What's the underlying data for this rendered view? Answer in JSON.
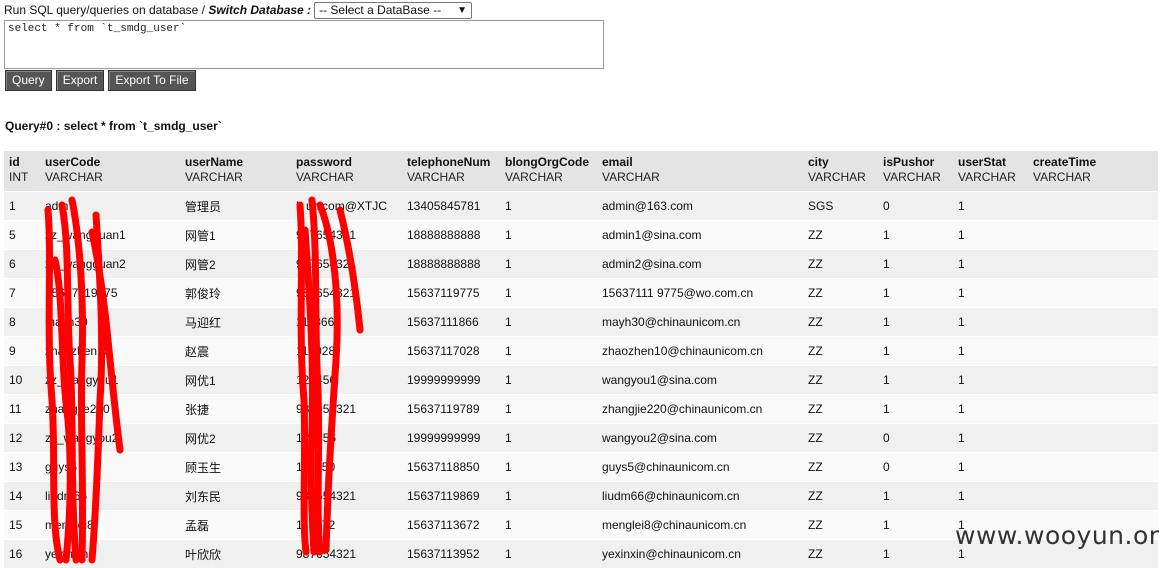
{
  "top": {
    "label_run": "Run SQL query/queries on database / ",
    "label_switch": "Switch Database :",
    "db_select": "-- Select a DataBase --"
  },
  "query_text": "select * from `t_smdg_user`",
  "buttons": {
    "query": "Query",
    "export": "Export",
    "export_file": "Export To File"
  },
  "query_title": "Query#0 : select * from `t_smdg_user`",
  "table": {
    "columns": [
      {
        "name": "id",
        "type": "INT"
      },
      {
        "name": "userCode",
        "type": "VARCHAR"
      },
      {
        "name": "userName",
        "type": "VARCHAR"
      },
      {
        "name": "password",
        "type": "VARCHAR"
      },
      {
        "name": "telephoneNum",
        "type": "VARCHAR"
      },
      {
        "name": "blongOrgCode",
        "type": "VARCHAR"
      },
      {
        "name": "email",
        "type": "VARCHAR"
      },
      {
        "name": "city",
        "type": "VARCHAR"
      },
      {
        "name": "isPushor",
        "type": "VARCHAR"
      },
      {
        "name": "userStat",
        "type": "VARCHAR"
      },
      {
        "name": "createTime",
        "type": "VARCHAR"
      }
    ],
    "rows": [
      [
        "1",
        "adm",
        "管理员",
        "h unicom@XTJC",
        "13405845781",
        "1",
        "admin@163.com",
        "SGS",
        "0",
        "1",
        ""
      ],
      [
        "5",
        "zz_wangguan1",
        "网管1",
        "987654321",
        "18888888888",
        "1",
        "admin1@sina.com",
        "ZZ",
        "1",
        "1",
        ""
      ],
      [
        "6",
        "zz_wangguan2",
        "网管2",
        "987654321",
        "18888888888",
        "1",
        "admin2@sina.com",
        "ZZ",
        "1",
        "1",
        ""
      ],
      [
        "7",
        "15637119775",
        "郭俊玲",
        "987654321",
        "15637119775",
        "1",
        "15637111 9775@wo.com.cn",
        "ZZ",
        "1",
        "1",
        ""
      ],
      [
        "8",
        "mayh30",
        "马迎红",
        "111866",
        "15637111866",
        "1",
        "mayh30@chinaunicom.cn",
        "ZZ",
        "1",
        "1",
        ""
      ],
      [
        "9",
        "zhaozhen10",
        "赵震",
        "117028",
        "15637117028",
        "1",
        "zhaozhen10@chinaunicom.cn",
        "ZZ",
        "1",
        "1",
        ""
      ],
      [
        "10",
        "zz_wangyou1",
        "网优1",
        "123456",
        "19999999999",
        "1",
        "wangyou1@sina.com",
        "ZZ",
        "1",
        "1",
        ""
      ],
      [
        "11",
        "zhangjie220",
        "张捷",
        "987654321",
        "15637119789",
        "1",
        "zhangjie220@chinaunicom.cn",
        "ZZ",
        "1",
        "1",
        ""
      ],
      [
        "12",
        "zz_wangyou2",
        "网优2",
        "123456",
        "19999999999",
        "1",
        "wangyou2@sina.com",
        "ZZ",
        "0",
        "1",
        ""
      ],
      [
        "13",
        "guys5",
        "顾玉生",
        "118850",
        "15637118850",
        "1",
        "guys5@chinaunicom.cn",
        "ZZ",
        "0",
        "1",
        ""
      ],
      [
        "14",
        "liudm66",
        "刘东民",
        "987654321",
        "15637119869",
        "1",
        "liudm66@chinaunicom.cn",
        "ZZ",
        "1",
        "1",
        ""
      ],
      [
        "15",
        "menglei8",
        "孟磊",
        "113672",
        "15637113672",
        "1",
        "menglei8@chinaunicom.cn",
        "ZZ",
        "1",
        "1",
        ""
      ],
      [
        "16",
        "yexinxin",
        "叶欣欣",
        "987654321",
        "15637113952",
        "1",
        "yexinxin@chinaunicom.cn",
        "ZZ",
        "1",
        "1",
        ""
      ]
    ]
  },
  "watermark": "www.wooyun.org"
}
